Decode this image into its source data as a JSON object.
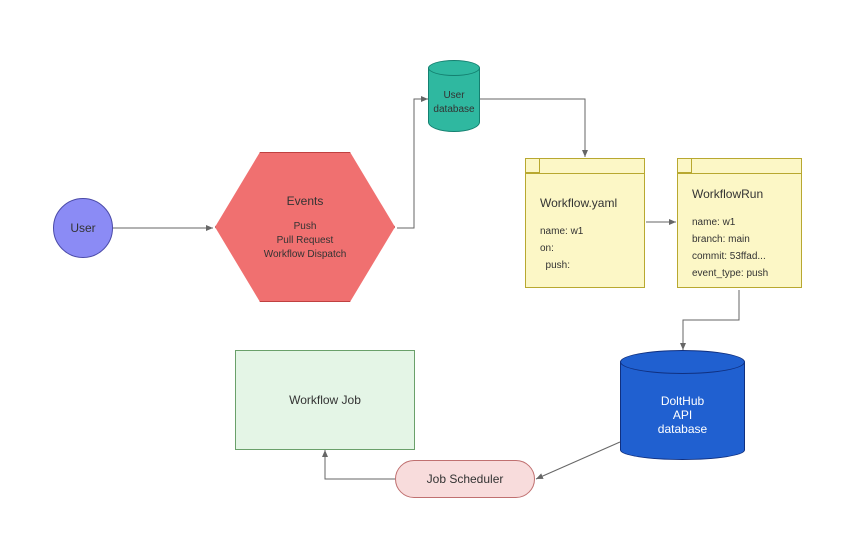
{
  "user": {
    "label": "User"
  },
  "events": {
    "title": "Events",
    "items": [
      "Push",
      "Pull Request",
      "Workflow Dispatch"
    ]
  },
  "user_db": {
    "label1": "User",
    "label2": "database"
  },
  "workflow_yaml": {
    "title": "Workflow.yaml",
    "lines": [
      "name: w1",
      "on:",
      "  push:"
    ]
  },
  "workflow_run": {
    "title": "WorkflowRun",
    "lines": [
      "name: w1",
      "branch: main",
      "commit: 53ffad...",
      "event_type: push"
    ]
  },
  "api_db": {
    "label1": "DoltHub",
    "label2": "API",
    "label3": "database"
  },
  "workflow_job": {
    "label": "Workflow Job"
  },
  "job_scheduler": {
    "label": "Job Scheduler"
  }
}
